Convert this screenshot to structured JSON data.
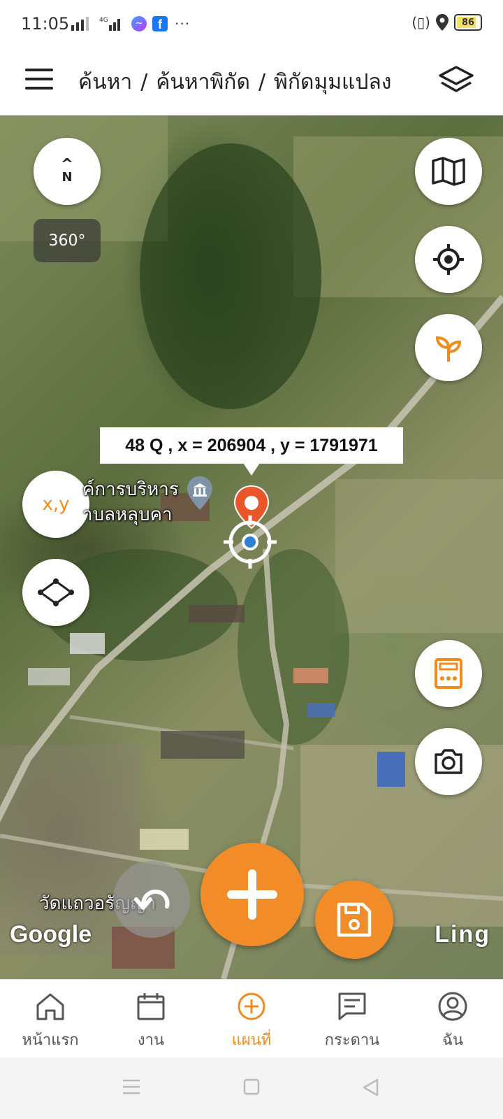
{
  "status_bar": {
    "time": "11:05",
    "network": "4G",
    "battery": "86",
    "battery_level": 0.86
  },
  "header": {
    "breadcrumb": [
      "ค้นหา",
      "ค้นหาพิกัด",
      "พิกัดมุมแปลง"
    ],
    "separator": "/"
  },
  "map": {
    "compass_n": "N",
    "compass_arrow": "^",
    "rotation": "360°",
    "xy_button": "x,y",
    "coordinate": "48 Q , x = 206904 , y = 1791971",
    "place_label_1": "ค์การบริหาร",
    "place_label_2": "าบลหลุบคา",
    "temple_label": "วัดแถวอรัญญา",
    "provider": "Google",
    "ling": "Ling"
  },
  "bottom_nav": [
    {
      "label": "หน้าแรก",
      "icon": "home-icon"
    },
    {
      "label": "งาน",
      "icon": "calendar-icon"
    },
    {
      "label": "แผนที่",
      "icon": "add-circle-icon",
      "active": true
    },
    {
      "label": "กระดาน",
      "icon": "board-icon"
    },
    {
      "label": "ฉัน",
      "icon": "user-icon"
    }
  ],
  "colors": {
    "accent": "#f28c28",
    "active_nav": "#f08c1e"
  }
}
